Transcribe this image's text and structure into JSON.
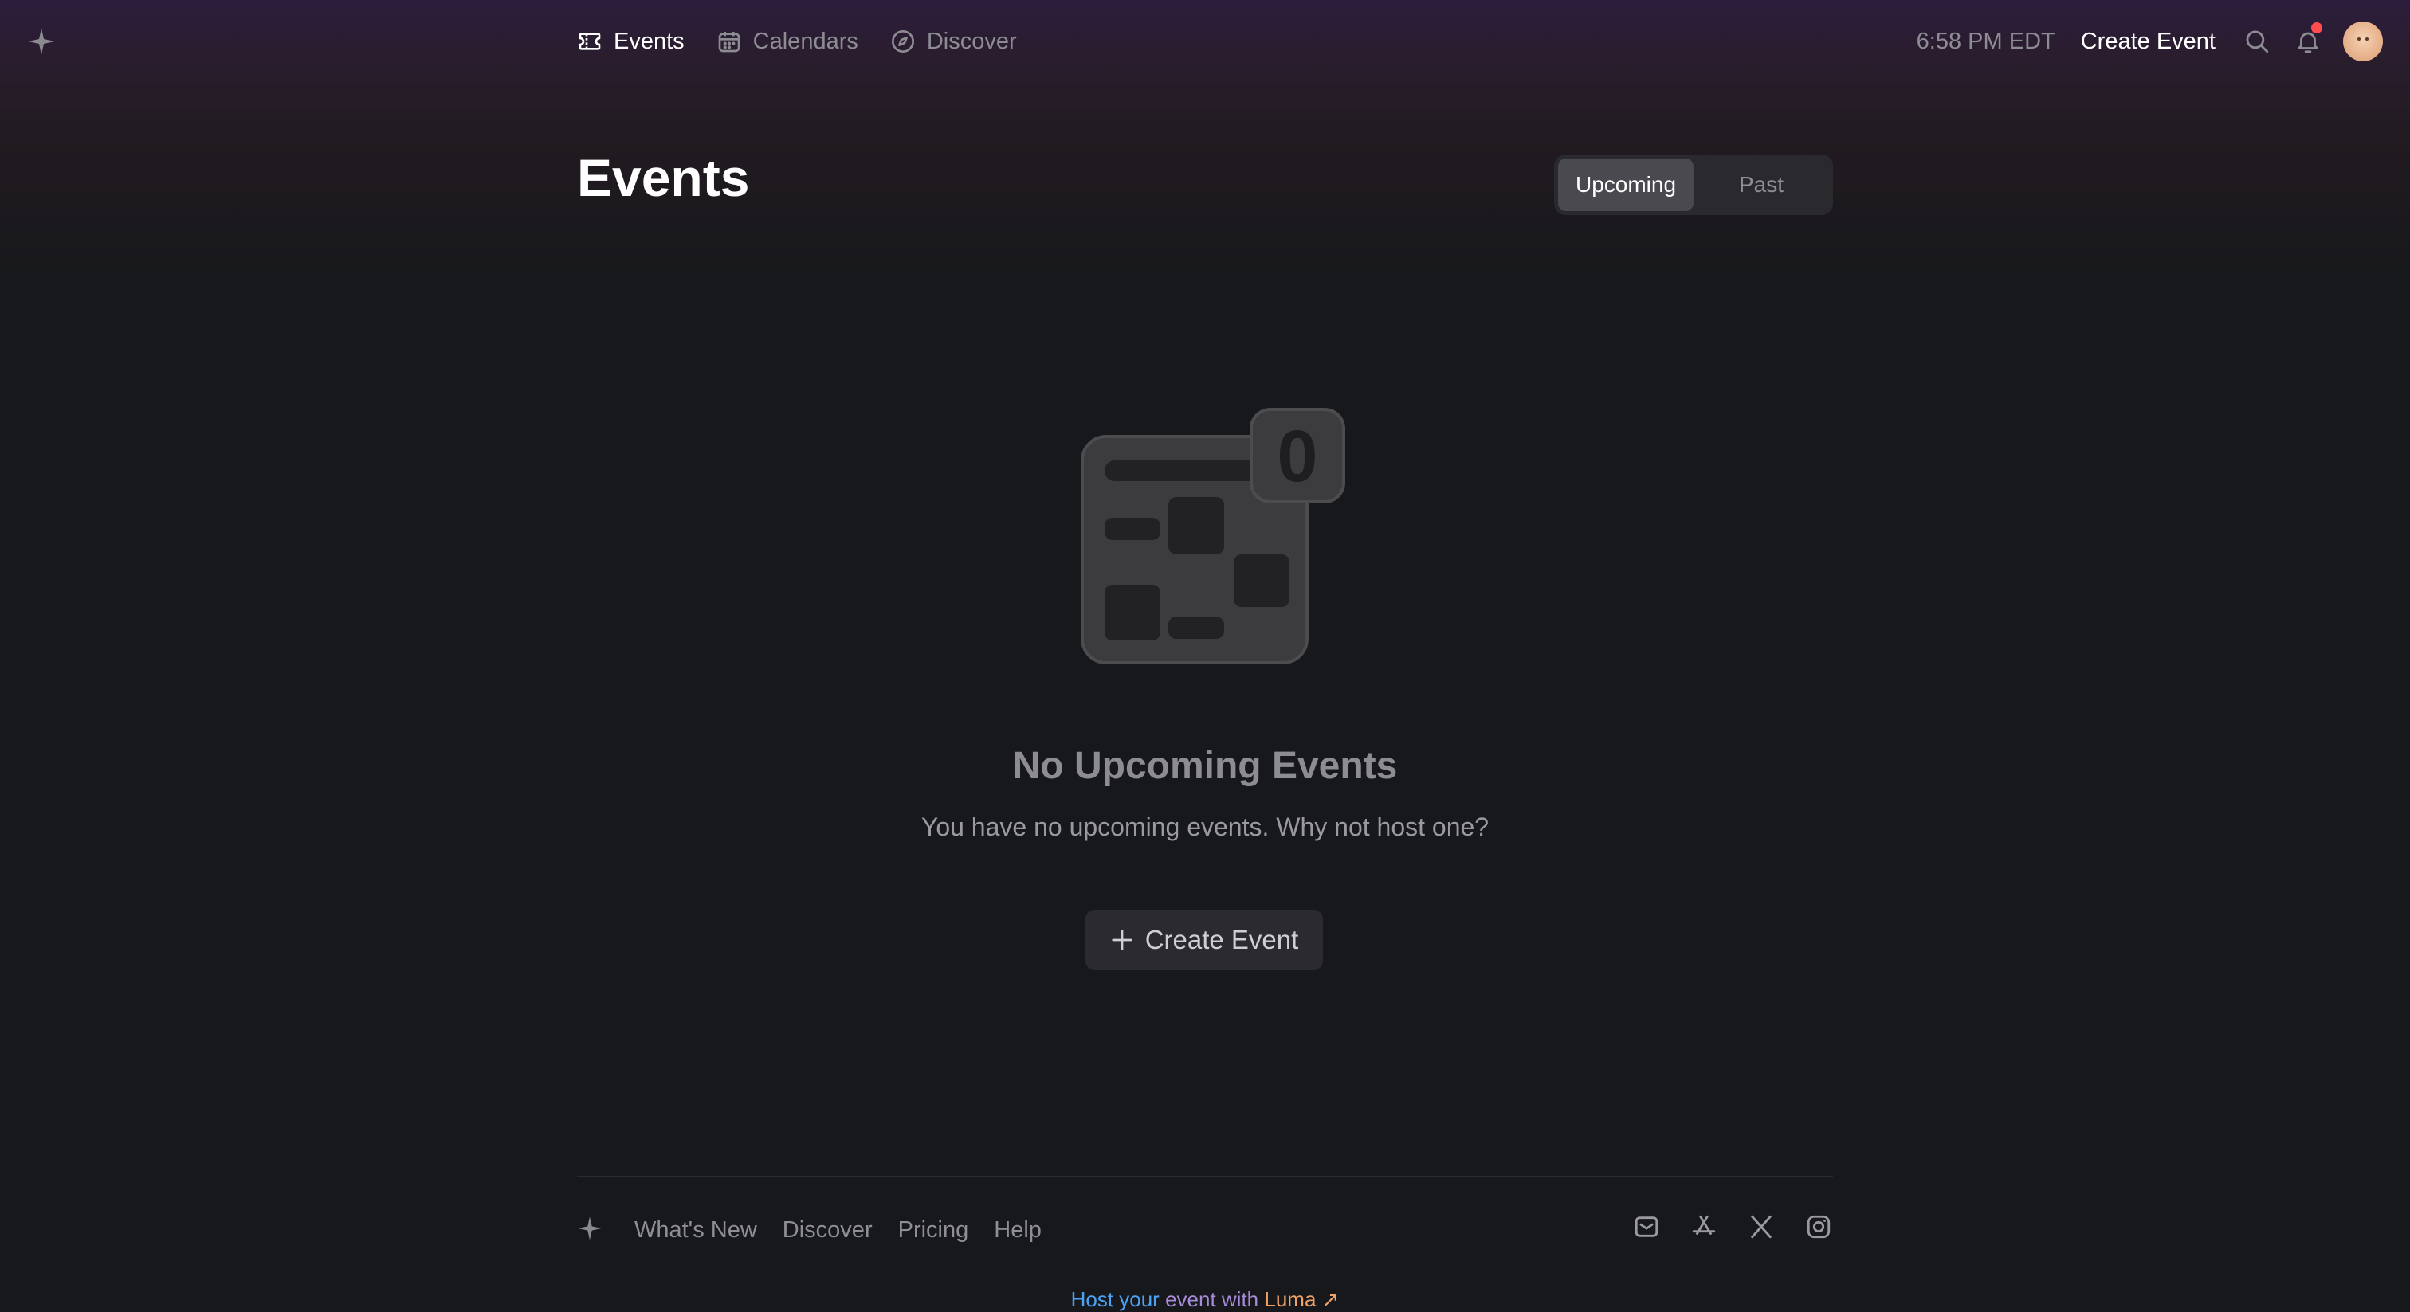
{
  "nav": {
    "items": [
      {
        "label": "Events",
        "icon": "ticket-icon",
        "active": true
      },
      {
        "label": "Calendars",
        "icon": "calendar-icon",
        "active": false
      },
      {
        "label": "Discover",
        "icon": "compass-icon",
        "active": false
      }
    ]
  },
  "topbar": {
    "time": "6:58 PM EDT",
    "create_label": "Create Event",
    "has_notification": true
  },
  "header": {
    "title": "Events",
    "tabs": [
      {
        "label": "Upcoming",
        "active": true
      },
      {
        "label": "Past",
        "active": false
      }
    ]
  },
  "empty_state": {
    "badge_count": "0",
    "title": "No Upcoming Events",
    "subtitle": "You have no upcoming events. Why not host one?",
    "button_label": "Create Event"
  },
  "footer": {
    "links": [
      "What's New",
      "Discover",
      "Pricing",
      "Help"
    ],
    "socials": [
      "mail-icon",
      "app-store-icon",
      "x-twitter-icon",
      "instagram-icon"
    ],
    "host": {
      "part1": "Host your",
      "part2": "event with",
      "part3": "Luma ↗"
    }
  },
  "colors": {
    "background": "#17181b",
    "header_gradient_top": "#2c1d3c",
    "notification_dot": "#ff4d4f",
    "host_blue": "#4aa3f5",
    "host_purple": "#a68bd9",
    "host_orange": "#f0a266"
  }
}
